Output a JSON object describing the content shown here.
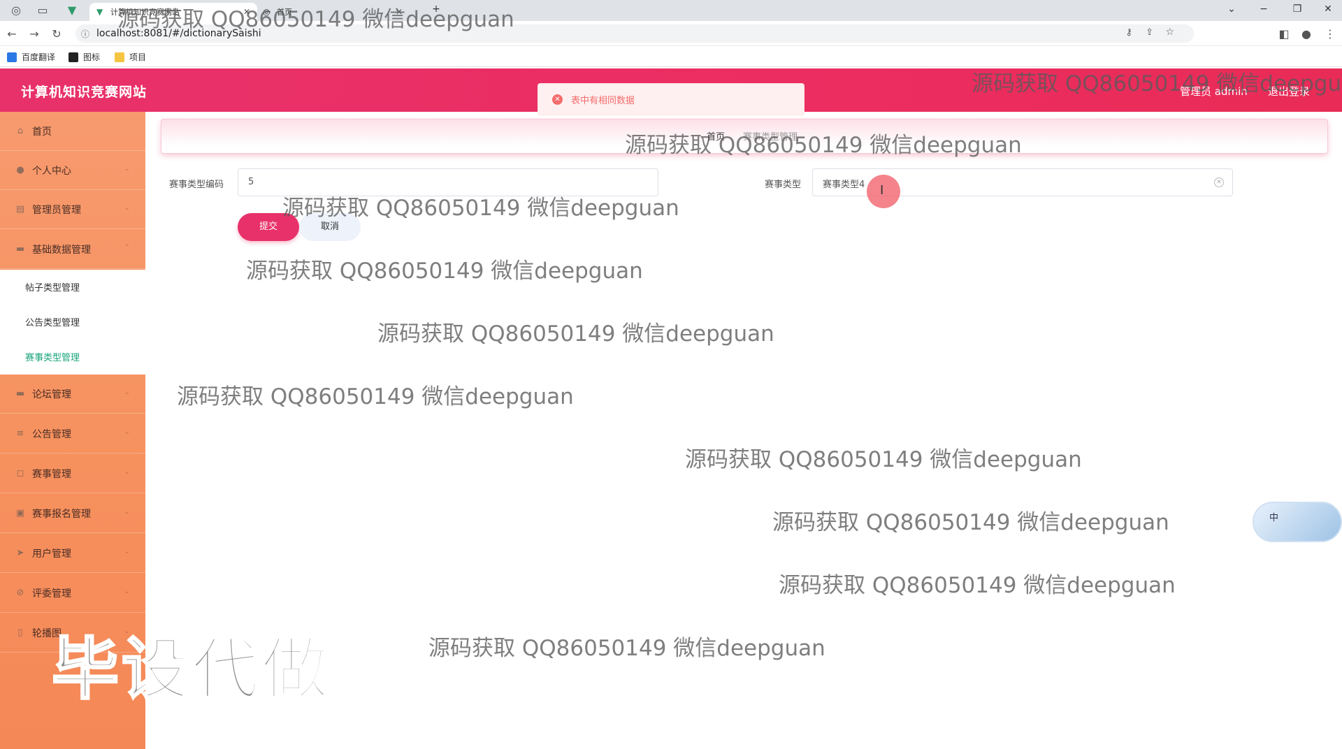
{
  "browser": {
    "tabs": [
      {
        "label": "计算机知识竞赛网站",
        "active": true
      },
      {
        "label": "首页",
        "active": false
      }
    ],
    "new_tab": "+",
    "url": "localhost:8081/#/dictionarySaishi",
    "bookmarks": [
      "百度翻译",
      "图标",
      "项目"
    ]
  },
  "header": {
    "title": "计算机知识竞赛网站",
    "user": "管理员 admin",
    "logout": "退出登录",
    "brand_color": "#e92b57"
  },
  "toast": {
    "message": "表中有相同数据",
    "type": "error"
  },
  "sidebar": {
    "items": [
      {
        "label": "首页",
        "icon": "home-icon"
      },
      {
        "label": "个人中心",
        "icon": "user-icon"
      },
      {
        "label": "管理员管理",
        "icon": "admin-icon"
      },
      {
        "label": "基础数据管理",
        "icon": "data-icon",
        "expanded": true
      },
      {
        "label": "论坛管理",
        "icon": "forum-icon"
      },
      {
        "label": "公告管理",
        "icon": "notice-icon"
      },
      {
        "label": "赛事管理",
        "icon": "event-icon"
      },
      {
        "label": "赛事报名管理",
        "icon": "signup-icon"
      },
      {
        "label": "用户管理",
        "icon": "users-icon"
      },
      {
        "label": "评委管理",
        "icon": "judge-icon"
      },
      {
        "label": "轮播图",
        "icon": "carousel-icon"
      }
    ],
    "subitems": [
      {
        "label": "帖子类型管理",
        "active": false
      },
      {
        "label": "公告类型管理",
        "active": false
      },
      {
        "label": "赛事类型管理",
        "active": true
      }
    ],
    "gradient_color": "#f6925f"
  },
  "breadcrumb": {
    "home": "首页",
    "current": "赛事类型管理"
  },
  "form": {
    "code_label": "赛事类型编码",
    "code_value": "5",
    "type_label": "赛事类型",
    "type_value": "赛事类型4",
    "submit": "提交",
    "cancel": "取消"
  },
  "widget": {
    "text": "中"
  },
  "watermarks": {
    "text": "源码获取 QQ86050149 微信deepguan",
    "big": "毕设代做"
  }
}
